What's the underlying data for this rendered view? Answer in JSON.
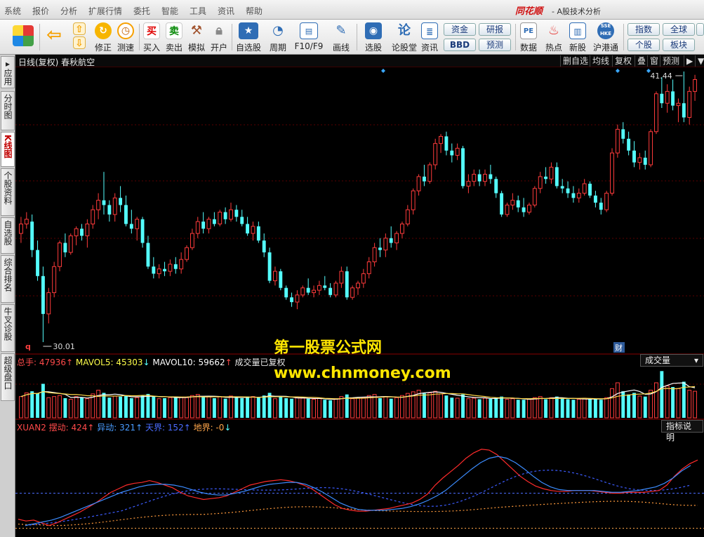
{
  "menu": {
    "items": [
      "系统",
      "报价",
      "分析",
      "扩展行情",
      "委托",
      "智能",
      "工具",
      "资讯",
      "帮助"
    ],
    "brand": "同花顺",
    "app_title": "- A股技术分析"
  },
  "toolbar": {
    "items": [
      {
        "label": "修正",
        "icon": "refresh-icon"
      },
      {
        "label": "测速",
        "icon": "clock-icon"
      },
      {
        "label": "买入",
        "icon": "buy-icon",
        "glyph": "买"
      },
      {
        "label": "卖出",
        "icon": "sell-icon",
        "glyph": "卖"
      },
      {
        "label": "模拟",
        "icon": "hammer-icon"
      },
      {
        "label": "开户",
        "icon": "lock-icon"
      },
      {
        "label": "自选股",
        "icon": "star-icon"
      },
      {
        "label": "周期",
        "icon": "cycle-icon"
      },
      {
        "label": "F10/F9",
        "icon": "f10-icon"
      },
      {
        "label": "画线",
        "icon": "pencil-icon"
      },
      {
        "label": "选股",
        "icon": "select-icon"
      },
      {
        "label": "论股堂",
        "icon": "forum-icon",
        "glyph": "论"
      },
      {
        "label": "资讯",
        "icon": "news-icon"
      },
      {
        "label": "数据",
        "icon": "pe-icon",
        "glyph": "PE"
      },
      {
        "label": "热点",
        "icon": "hot-icon"
      },
      {
        "label": "新股",
        "icon": "newstock-icon"
      },
      {
        "label": "沪港通",
        "icon": "hk-icon",
        "glyph": "SSE HKE"
      }
    ],
    "small_buttons": [
      "资金",
      "BBD",
      "研报",
      "预测",
      "指数",
      "个股",
      "全球",
      "板块"
    ]
  },
  "left_tabs": [
    "应用",
    "分时图",
    "K线图",
    "个股资料",
    "自选股",
    "综合排名",
    "牛叉诊股",
    "超级盘口"
  ],
  "kline_header": {
    "title": "日线(复权) 春秋航空",
    "buttons": [
      "删自选",
      "均线",
      "复权",
      "叠",
      "窗",
      "预测"
    ]
  },
  "price_panel": {
    "high_label": "41.44",
    "low_label": "30.01",
    "marker_q": "q",
    "marker_cai": "财"
  },
  "volume_panel": {
    "label_total": "总手: 47936",
    "label_ma5": "MAVOL5: 45303",
    "label_ma10": "MAVOL10: 59662",
    "label_note": "成交量已复权",
    "dropdown": "成交量"
  },
  "indicator_panel": {
    "name": "XUAN2",
    "l1": "摆动: 424",
    "l2": "异动: 321",
    "l3": "天界: 152",
    "l4": "地界: -0",
    "help_button": "指标说明"
  },
  "watermark": {
    "line1": "第一股票公式网",
    "line2": "www.chnmoney.com"
  },
  "colors": {
    "up": "#ff3b3b",
    "down": "#54ffff",
    "accent_red": "#d01010",
    "watermark": "#ffe600",
    "indicator_red": "#ff2b2b",
    "indicator_blue": "#3c8cff"
  },
  "chart_data": {
    "type": "candlestick",
    "candles": [
      [
        34.6,
        35.3,
        34.2,
        35.0
      ],
      [
        35.0,
        35.5,
        34.8,
        35.2
      ],
      [
        35.1,
        35.4,
        33.6,
        33.9
      ],
      [
        33.9,
        34.3,
        32.6,
        32.8
      ],
      [
        32.8,
        33.2,
        30.01,
        31.2
      ],
      [
        31.2,
        32.3,
        30.8,
        32.1
      ],
      [
        32.1,
        33.4,
        31.9,
        33.2
      ],
      [
        33.2,
        34.3,
        33.0,
        34.2
      ],
      [
        34.2,
        34.6,
        33.6,
        33.8
      ],
      [
        33.8,
        34.6,
        33.7,
        34.5
      ],
      [
        34.5,
        34.9,
        34.1,
        34.8
      ],
      [
        34.8,
        35.0,
        34.3,
        34.5
      ],
      [
        34.5,
        35.2,
        34.0,
        35.0
      ],
      [
        35.0,
        35.8,
        34.8,
        35.6
      ],
      [
        35.6,
        36.3,
        35.2,
        36.0
      ],
      [
        36.0,
        37.2,
        35.4,
        35.8
      ],
      [
        35.8,
        36.0,
        35.1,
        35.4
      ],
      [
        35.4,
        36.3,
        35.1,
        36.1
      ],
      [
        36.1,
        36.6,
        35.5,
        35.8
      ],
      [
        35.8,
        36.2,
        34.9,
        35.0
      ],
      [
        35.0,
        35.6,
        34.6,
        34.8
      ],
      [
        34.8,
        35.3,
        34.3,
        35.2
      ],
      [
        35.2,
        35.3,
        34.0,
        34.2
      ],
      [
        34.2,
        34.5,
        33.1,
        33.2
      ],
      [
        33.2,
        33.6,
        32.7,
        32.9
      ],
      [
        32.9,
        33.3,
        32.7,
        33.1
      ],
      [
        33.1,
        33.4,
        32.8,
        33.0
      ],
      [
        33.0,
        33.5,
        32.8,
        33.3
      ],
      [
        33.3,
        33.6,
        32.9,
        33.1
      ],
      [
        33.1,
        33.8,
        32.9,
        33.5
      ],
      [
        33.5,
        34.1,
        33.4,
        34.0
      ],
      [
        34.0,
        34.8,
        33.9,
        34.6
      ],
      [
        34.6,
        35.3,
        34.4,
        35.1
      ],
      [
        35.1,
        35.5,
        34.6,
        34.8
      ],
      [
        34.8,
        35.3,
        34.6,
        35.2
      ],
      [
        35.2,
        35.5,
        34.9,
        35.0
      ],
      [
        35.0,
        35.6,
        34.9,
        35.5
      ],
      [
        35.5,
        35.7,
        35.0,
        35.2
      ],
      [
        35.2,
        35.9,
        35.1,
        35.6
      ],
      [
        35.6,
        35.8,
        35.1,
        35.3
      ],
      [
        35.3,
        35.6,
        34.9,
        35.0
      ],
      [
        35.0,
        35.3,
        34.5,
        34.6
      ],
      [
        34.6,
        35.1,
        34.3,
        34.9
      ],
      [
        34.9,
        35.1,
        34.2,
        34.3
      ],
      [
        34.3,
        34.6,
        33.6,
        33.8
      ],
      [
        33.8,
        34.0,
        32.5,
        32.6
      ],
      [
        32.6,
        33.2,
        32.4,
        33.0
      ],
      [
        33.0,
        33.1,
        32.2,
        32.3
      ],
      [
        32.3,
        32.4,
        31.8,
        31.9
      ],
      [
        31.9,
        32.1,
        31.5,
        31.7
      ],
      [
        31.7,
        32.2,
        31.4,
        32.0
      ],
      [
        32.0,
        32.4,
        31.9,
        32.3
      ],
      [
        32.3,
        32.7,
        32.0,
        32.1
      ],
      [
        32.1,
        32.4,
        31.9,
        32.2
      ],
      [
        32.2,
        32.6,
        32.0,
        32.4
      ],
      [
        32.4,
        32.8,
        32.2,
        32.3
      ],
      [
        32.3,
        32.5,
        31.9,
        32.0
      ],
      [
        32.0,
        32.6,
        31.9,
        32.5
      ],
      [
        32.5,
        33.2,
        32.3,
        33.0
      ],
      [
        33.0,
        33.2,
        31.8,
        31.9
      ],
      [
        31.9,
        32.4,
        31.8,
        32.3
      ],
      [
        32.3,
        32.6,
        32.0,
        32.5
      ],
      [
        32.5,
        33.1,
        32.3,
        32.9
      ],
      [
        32.9,
        33.6,
        32.7,
        33.4
      ],
      [
        33.4,
        34.2,
        33.2,
        34.0
      ],
      [
        34.0,
        34.4,
        33.6,
        33.9
      ],
      [
        33.9,
        34.6,
        33.6,
        34.4
      ],
      [
        34.4,
        34.9,
        34.0,
        34.2
      ],
      [
        34.2,
        34.7,
        33.9,
        34.6
      ],
      [
        34.6,
        35.1,
        34.4,
        35.0
      ],
      [
        35.0,
        35.8,
        34.9,
        35.6
      ],
      [
        35.6,
        36.5,
        35.4,
        36.4
      ],
      [
        36.4,
        37.1,
        36.2,
        37.0
      ],
      [
        37.0,
        37.5,
        36.6,
        36.8
      ],
      [
        36.8,
        37.6,
        36.7,
        37.5
      ],
      [
        37.5,
        38.6,
        37.3,
        38.4
      ],
      [
        38.4,
        38.8,
        38.0,
        38.7
      ],
      [
        38.7,
        38.9,
        37.9,
        38.1
      ],
      [
        38.1,
        38.4,
        37.6,
        37.9
      ],
      [
        37.9,
        38.4,
        37.7,
        38.2
      ],
      [
        38.2,
        38.3,
        36.5,
        36.6
      ],
      [
        36.6,
        37.1,
        36.3,
        36.8
      ],
      [
        36.8,
        37.3,
        36.6,
        37.1
      ],
      [
        37.1,
        37.3,
        36.6,
        36.8
      ],
      [
        36.8,
        37.3,
        36.6,
        37.1
      ],
      [
        37.1,
        37.5,
        36.7,
        36.9
      ],
      [
        36.9,
        37.0,
        36.1,
        36.3
      ],
      [
        36.3,
        36.4,
        35.3,
        35.4
      ],
      [
        35.4,
        35.9,
        35.3,
        35.8
      ],
      [
        35.8,
        36.3,
        35.6,
        36.0
      ],
      [
        36.0,
        36.2,
        35.5,
        35.7
      ],
      [
        35.7,
        36.1,
        35.3,
        35.5
      ],
      [
        35.5,
        35.9,
        35.4,
        35.8
      ],
      [
        35.8,
        36.6,
        35.7,
        36.5
      ],
      [
        36.5,
        37.2,
        36.3,
        37.0
      ],
      [
        37.0,
        37.4,
        36.7,
        36.9
      ],
      [
        36.9,
        37.6,
        36.7,
        37.4
      ],
      [
        37.4,
        37.6,
        36.5,
        36.6
      ],
      [
        36.6,
        36.9,
        36.3,
        36.5
      ],
      [
        36.5,
        36.8,
        36.1,
        36.3
      ],
      [
        36.3,
        36.6,
        35.9,
        36.1
      ],
      [
        36.1,
        36.5,
        35.9,
        36.3
      ],
      [
        36.3,
        36.9,
        36.2,
        36.7
      ],
      [
        36.7,
        36.8,
        36.1,
        36.2
      ],
      [
        36.2,
        36.4,
        35.7,
        35.9
      ],
      [
        35.9,
        36.1,
        35.4,
        35.6
      ],
      [
        35.6,
        36.4,
        35.5,
        36.3
      ],
      [
        36.3,
        38.2,
        36.2,
        38.0
      ],
      [
        38.0,
        39.2,
        37.8,
        39.0
      ],
      [
        39.0,
        39.3,
        38.4,
        38.6
      ],
      [
        38.6,
        38.9,
        37.9,
        38.1
      ],
      [
        38.1,
        38.5,
        37.4,
        37.6
      ],
      [
        37.6,
        38.0,
        37.3,
        37.8
      ],
      [
        37.8,
        38.1,
        37.3,
        37.5
      ],
      [
        37.5,
        39.0,
        37.4,
        38.9
      ],
      [
        38.9,
        40.6,
        38.8,
        40.5
      ],
      [
        40.5,
        41.2,
        39.9,
        40.1
      ],
      [
        40.1,
        40.9,
        39.7,
        40.6
      ],
      [
        40.6,
        41.1,
        39.8,
        40.0
      ],
      [
        40.0,
        40.3,
        39.3,
        40.1
      ],
      [
        40.1,
        41.44,
        39.3,
        39.5
      ],
      [
        39.5,
        40.8,
        39.2,
        40.6
      ],
      [
        40.6,
        41.3,
        40.2,
        41.1
      ]
    ],
    "volume": [
      40,
      47,
      50,
      46,
      64,
      38,
      40,
      42,
      37,
      35,
      40,
      38,
      36,
      45,
      52,
      47,
      38,
      41,
      40,
      42,
      37,
      38,
      42,
      45,
      40,
      36,
      37,
      38,
      40,
      39,
      38,
      42,
      44,
      40,
      40,
      37,
      40,
      36,
      41,
      38,
      37,
      40,
      40,
      38,
      42,
      47,
      36,
      40,
      37,
      36,
      38,
      37,
      36,
      35,
      37,
      34,
      33,
      36,
      40,
      44,
      36,
      37,
      38,
      42,
      44,
      37,
      40,
      36,
      38,
      42,
      46,
      49,
      52,
      46,
      47,
      50,
      45,
      42,
      38,
      37,
      44,
      36,
      37,
      35,
      37,
      36,
      38,
      40,
      35,
      36,
      34,
      34,
      35,
      38,
      40,
      35,
      38,
      40,
      36,
      35,
      34,
      35,
      37,
      35,
      36,
      34,
      38,
      55,
      66,
      50,
      44,
      47,
      41,
      40,
      52,
      66,
      88,
      60,
      58,
      55,
      68,
      52,
      50
    ],
    "indicator": {
      "xuan_red": [
        0.12,
        0.1,
        0.11,
        0.08,
        0.05,
        0.08,
        0.12,
        0.16,
        0.2,
        0.25,
        0.3,
        0.36,
        0.42,
        0.46,
        0.5,
        0.52,
        0.53,
        0.55,
        0.53,
        0.5,
        0.47,
        0.42,
        0.38,
        0.36,
        0.34,
        0.35,
        0.36,
        0.38,
        0.42,
        0.46,
        0.5,
        0.52,
        0.54,
        0.55,
        0.56,
        0.55,
        0.53,
        0.5,
        0.46,
        0.4,
        0.34,
        0.28,
        0.24,
        0.22,
        0.21,
        0.21,
        0.22,
        0.23,
        0.24,
        0.26,
        0.28,
        0.3,
        0.34,
        0.4,
        0.5,
        0.58,
        0.65,
        0.72,
        0.8,
        0.86,
        0.9,
        0.89,
        0.84,
        0.76,
        0.68,
        0.6,
        0.54,
        0.49,
        0.46,
        0.44,
        0.43,
        0.43,
        0.44,
        0.44,
        0.44,
        0.43,
        0.42,
        0.41,
        0.41,
        0.42,
        0.42,
        0.42,
        0.43,
        0.44,
        0.5,
        0.6,
        0.68,
        0.74,
        0.78
      ],
      "xuan_blue": [
        0.05,
        0.07,
        0.09,
        0.11,
        0.14,
        0.18,
        0.22,
        0.26,
        0.3,
        0.34,
        0.38,
        0.42,
        0.45,
        0.48,
        0.5,
        0.51,
        0.51,
        0.5,
        0.48,
        0.45,
        0.42,
        0.4,
        0.39,
        0.39,
        0.41,
        0.43,
        0.46,
        0.49,
        0.51,
        0.52,
        0.53,
        0.53,
        0.51,
        0.47,
        0.42,
        0.36,
        0.3,
        0.26,
        0.23,
        0.22,
        0.22,
        0.22,
        0.23,
        0.24,
        0.26,
        0.29,
        0.33,
        0.38,
        0.44,
        0.52,
        0.6,
        0.68,
        0.75,
        0.8,
        0.82,
        0.8,
        0.75,
        0.68,
        0.6,
        0.53,
        0.48,
        0.45,
        0.44,
        0.44,
        0.44,
        0.44,
        0.43,
        0.42,
        0.42,
        0.43,
        0.44,
        0.46,
        0.48,
        0.52,
        0.58,
        0.66,
        0.72
      ],
      "tianjie_level": 0.41,
      "dijie_level": 0.02
    }
  }
}
